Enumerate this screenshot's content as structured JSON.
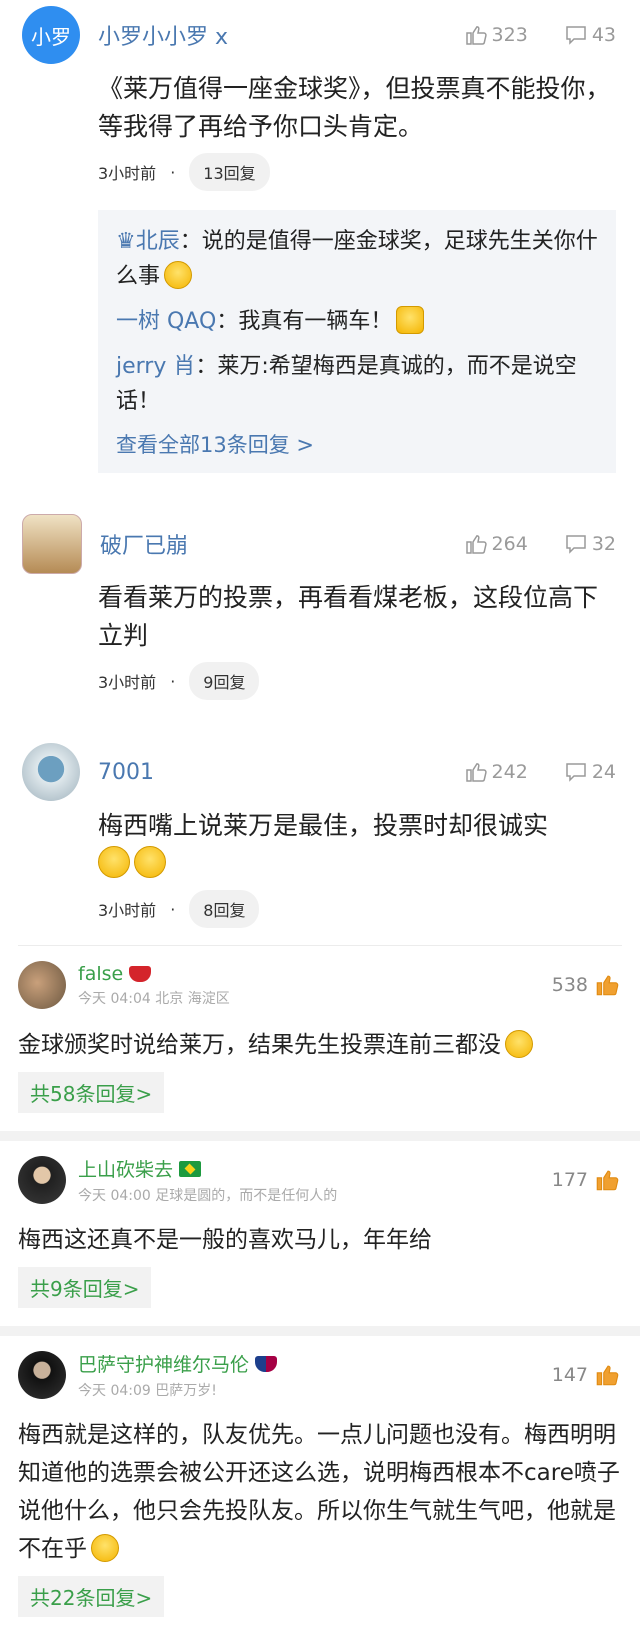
{
  "weibo": [
    {
      "avatar_text": "小罗",
      "name": "小罗小小罗 x",
      "likes": "323",
      "comments": "43",
      "text": "《莱万值得一座金球奖》，但投票真不能投你，等我得了再给予你口头肯定。",
      "time": "3小时前",
      "dot": "·",
      "reply_count": "13回复",
      "replies": [
        {
          "who": "♛北辰",
          "text": "说的是值得一座金球奖，足球先生关你什么事"
        },
        {
          "who": "一树 QAQ",
          "text": "我真有一辆车！"
        },
        {
          "who": "jerry 肖",
          "text": "莱万:希望梅西是真诚的，而不是说空话！"
        }
      ],
      "see_all": "查看全部13条回复 >"
    },
    {
      "name": "破厂已崩",
      "likes": "264",
      "comments": "32",
      "text": "看看莱万的投票，再看看煤老板，这段位高下立判",
      "time": "3小时前",
      "dot": "·",
      "reply_count": "9回复"
    },
    {
      "name": "7001",
      "likes": "242",
      "comments": "24",
      "text": "梅西嘴上说莱万是最佳，投票时却很诚实",
      "time": "3小时前",
      "dot": "·",
      "reply_count": "8回复"
    }
  ],
  "reply_colon": "：",
  "comments": [
    {
      "name": "false",
      "badge": "arsenal",
      "sub": "今天 04:04 北京 海淀区",
      "likes": "538",
      "text": "金球颁奖时说给莱万，结果先生投票连前三都没",
      "reply_btn": "共58条回复>"
    },
    {
      "name": "上山砍柴去",
      "badge": "brazil",
      "sub": "今天 04:00 足球是圆的，而不是任何人的",
      "likes": "177",
      "text": "梅西这还真不是一般的喜欢马儿，年年给",
      "reply_btn": "共9条回复>"
    },
    {
      "name": "巴萨守护神维尔马伦",
      "badge": "barcelona",
      "sub": "今天 04:09 巴萨万岁!",
      "likes": "147",
      "text": "梅西就是这样的，队友优先。一点儿问题也没有。梅西明明知道他的选票会被公开还这么选，说明梅西根本不care喷子说他什么，他只会先投队友。所以你生气就生气吧，他就是不在乎",
      "reply_btn": "共22条回复>"
    }
  ],
  "colors": {
    "link_blue": "#4a78b0",
    "green": "#3a9f4a",
    "like_orange": "#f0a030"
  }
}
